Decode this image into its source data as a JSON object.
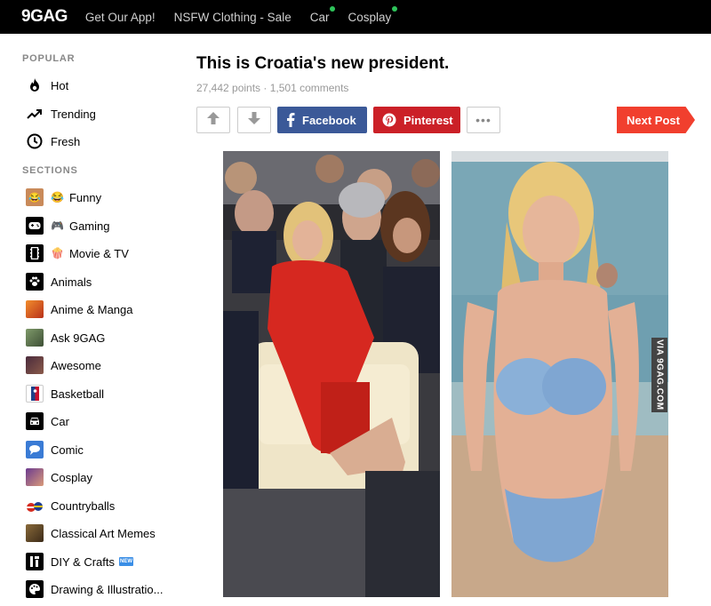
{
  "topbar": {
    "logo": "9GAG",
    "links": [
      {
        "label": "Get Our App!",
        "dot": false
      },
      {
        "label": "NSFW Clothing - Sale",
        "dot": false
      },
      {
        "label": "Car",
        "dot": true
      },
      {
        "label": "Cosplay",
        "dot": true
      }
    ]
  },
  "sidebar": {
    "popular_title": "POPULAR",
    "popular": [
      {
        "label": "Hot",
        "icon": "fire-icon"
      },
      {
        "label": "Trending",
        "icon": "trending-icon"
      },
      {
        "label": "Fresh",
        "icon": "clock-icon"
      }
    ],
    "sections_title": "SECTIONS",
    "sections": [
      {
        "label": "Funny",
        "icon": "funny-icon",
        "emoji": "😂"
      },
      {
        "label": "Gaming",
        "icon": "gaming-icon",
        "emoji": "🎮"
      },
      {
        "label": "Movie & TV",
        "icon": "movie-icon",
        "emoji": "🍿"
      },
      {
        "label": "Animals",
        "icon": "paw-icon"
      },
      {
        "label": "Anime & Manga",
        "icon": "anime-icon"
      },
      {
        "label": "Ask 9GAG",
        "icon": "ask-icon"
      },
      {
        "label": "Awesome",
        "icon": "awesome-icon"
      },
      {
        "label": "Basketball",
        "icon": "basketball-icon"
      },
      {
        "label": "Car",
        "icon": "car-icon"
      },
      {
        "label": "Comic",
        "icon": "comic-icon"
      },
      {
        "label": "Cosplay",
        "icon": "cosplay-icon"
      },
      {
        "label": "Countryballs",
        "icon": "countryballs-icon"
      },
      {
        "label": "Classical Art Memes",
        "icon": "art-icon"
      },
      {
        "label": "DIY & Crafts",
        "icon": "diy-icon",
        "badge": "NEW"
      },
      {
        "label": "Drawing & Illustratio...",
        "icon": "palette-icon"
      }
    ]
  },
  "post": {
    "title": "This is Croatia's new president.",
    "meta": "27,442 points · 1,501 comments",
    "facebook_label": "Facebook",
    "pinterest_label": "Pinterest",
    "more_label": "•••",
    "next_label": "Next Post",
    "watermark": "VIA 9GAG.COM"
  },
  "colors": {
    "facebook": "#3b5998",
    "pinterest": "#cb2027",
    "next": "#f13f2e",
    "online_dot": "#2ec35a"
  }
}
